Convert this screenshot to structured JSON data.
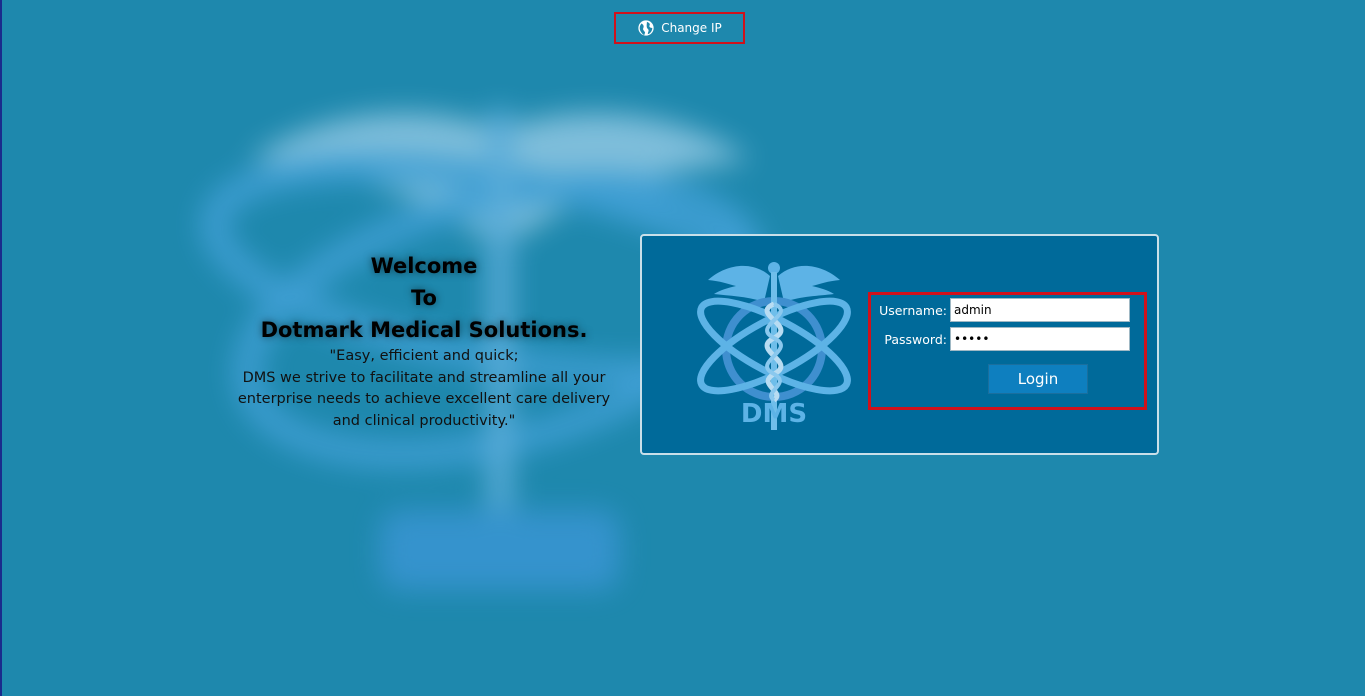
{
  "header": {
    "change_ip_label": "Change IP",
    "change_ip_icon": "globe-icon"
  },
  "welcome": {
    "line1": "Welcome",
    "line2": "To",
    "line3": "Dotmark Medical Solutions.",
    "quote_lines": [
      "\"Easy, efficient and quick;",
      "DMS we strive to facilitate and streamline all your",
      "enterprise needs to achieve excellent care delivery",
      "and clinical productivity.\""
    ]
  },
  "login": {
    "logo_text": "DMS",
    "username_label": "Username:",
    "username_value": "admin",
    "password_label": "Password:",
    "password_value": "admin",
    "login_button": "Login"
  },
  "colors": {
    "background": "#1e88ad",
    "panel": "#006a9a",
    "highlight_border": "#d0111b",
    "button": "#0e7fbf"
  }
}
